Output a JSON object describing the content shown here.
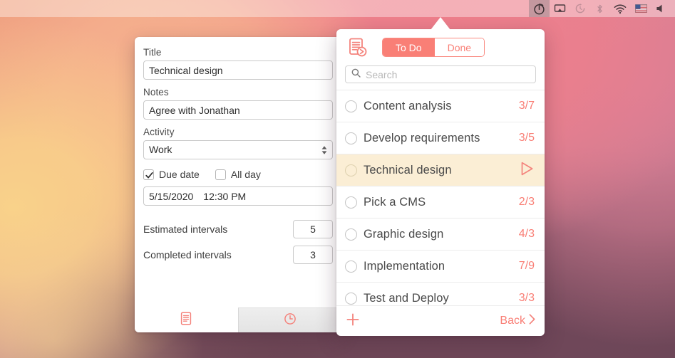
{
  "menubar": {
    "items": [
      {
        "name": "timer-app-icon",
        "active": true
      },
      {
        "name": "airplay-icon",
        "active": false
      },
      {
        "name": "time-machine-icon",
        "active": false
      },
      {
        "name": "bluetooth-icon",
        "active": false
      },
      {
        "name": "wifi-icon",
        "active": false
      },
      {
        "name": "input-flag-icon",
        "active": false
      },
      {
        "name": "volume-icon",
        "active": false
      }
    ]
  },
  "editor": {
    "title_label": "Title",
    "title_value": "Technical design",
    "notes_label": "Notes",
    "notes_value": "Agree with Jonathan",
    "activity_label": "Activity",
    "activity_value": "Work",
    "due_date_label": "Due date",
    "due_date_checked": true,
    "all_day_label": "All day",
    "all_day_checked": false,
    "date_value": "5/15/2020",
    "time_value": "12:30 PM",
    "estimated_label": "Estimated intervals",
    "estimated_value": "5",
    "completed_label": "Completed intervals",
    "completed_value": "3",
    "tabs": [
      {
        "name": "tab-details",
        "icon": "document-icon",
        "selected": true
      },
      {
        "name": "tab-history",
        "icon": "clock-icon",
        "selected": false
      }
    ]
  },
  "popover": {
    "app_icon": "task-document-play-icon",
    "segmented": {
      "todo_label": "To Do",
      "done_label": "Done",
      "selected": "To Do"
    },
    "search": {
      "placeholder": "Search",
      "value": "",
      "icon": "search-icon"
    },
    "tasks": [
      {
        "title": "Content analysis",
        "count": "3/7",
        "highlighted": false,
        "running": false
      },
      {
        "title": "Develop requirements",
        "count": "3/5",
        "highlighted": false,
        "running": false
      },
      {
        "title": "Technical design",
        "count": "",
        "highlighted": true,
        "running": true
      },
      {
        "title": "Pick a CMS",
        "count": "2/3",
        "highlighted": false,
        "running": false
      },
      {
        "title": "Graphic design",
        "count": "4/3",
        "highlighted": false,
        "running": false
      },
      {
        "title": "Implementation",
        "count": "7/9",
        "highlighted": false,
        "running": false
      },
      {
        "title": "Test and Deploy",
        "count": "3/3",
        "highlighted": false,
        "running": false
      }
    ],
    "footer": {
      "add_icon": "plus-icon",
      "back_label": "Back",
      "back_icon": "chevron-right-icon"
    }
  },
  "colors": {
    "accent": "#f97f76",
    "highlight_row": "#fbeed5",
    "text": "#4a4a4a",
    "panel": "#ffffff"
  }
}
